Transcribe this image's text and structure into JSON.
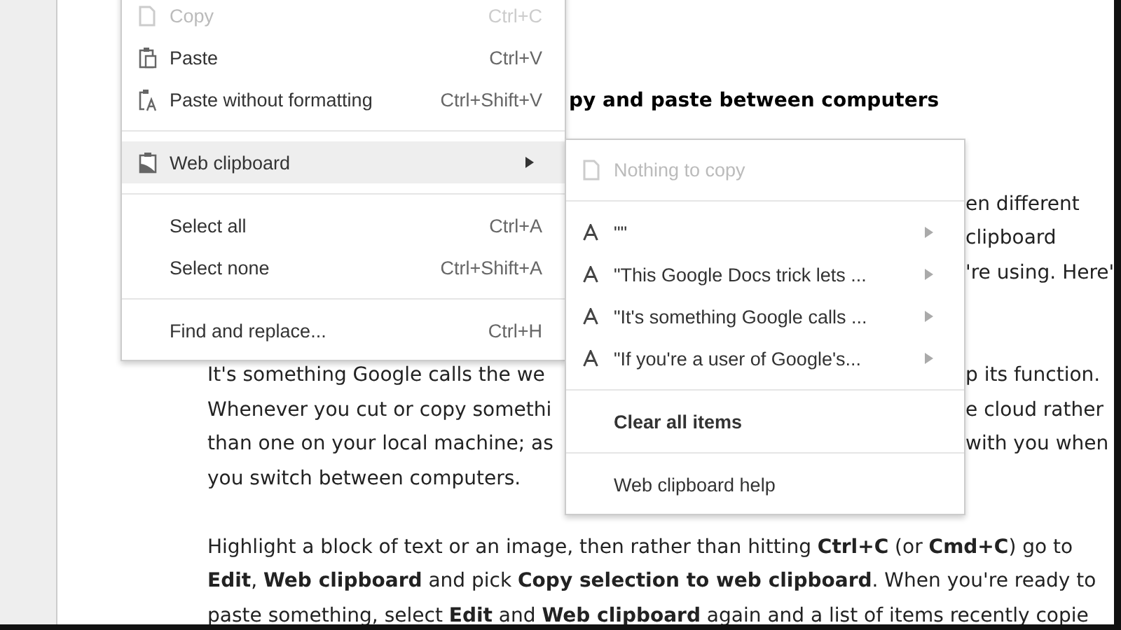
{
  "document": {
    "lines": [
      {
        "kind": "heading",
        "right": "py and paste between computers"
      },
      {
        "kind": "gap"
      },
      {
        "kind": "gap"
      },
      {
        "kind": "text",
        "right": "en different"
      },
      {
        "kind": "text",
        "right": "clipboard"
      },
      {
        "kind": "text",
        "right": "'re using. Here'"
      },
      {
        "kind": "gap"
      },
      {
        "kind": "gap"
      },
      {
        "kind": "text",
        "left": "It's something Google calls the we",
        "right": "p its function."
      },
      {
        "kind": "text",
        "left": "Whenever you cut or copy somethi",
        "right": "e cloud rather"
      },
      {
        "kind": "text",
        "left": "than one on your local machine; as",
        "right": "with you when"
      },
      {
        "kind": "text",
        "left": "you switch between computers."
      },
      {
        "kind": "gap"
      },
      {
        "kind": "text",
        "left": "Highlight a block of text or an image, then rather than hitting **Ctrl+C** (or **Cmd+C**) go to"
      },
      {
        "kind": "text",
        "left": "**Edit**, **Web clipboard** and pick **Copy selection to web clipboard**. When you're ready to"
      },
      {
        "kind": "text",
        "left": "paste something, select **Edit** and **Web clipboard** again and a list of items recently copie"
      }
    ]
  },
  "edit_menu": {
    "items": [
      {
        "kind": "item",
        "label": "Copy",
        "shortcut": "Ctrl+C",
        "disabled": true,
        "selected": false
      },
      {
        "kind": "item",
        "label": "Paste",
        "shortcut": "Ctrl+V",
        "disabled": false,
        "selected": false
      },
      {
        "kind": "item",
        "label": "Paste without formatting",
        "shortcut": "Ctrl+Shift+V",
        "disabled": false,
        "selected": false
      },
      {
        "kind": "separator"
      },
      {
        "kind": "item",
        "label": "Web clipboard",
        "submenu": true,
        "disabled": false,
        "selected": true
      },
      {
        "kind": "separator"
      },
      {
        "kind": "item",
        "label": "Select all",
        "shortcut": "Ctrl+A",
        "disabled": false,
        "selected": false
      },
      {
        "kind": "item",
        "label": "Select none",
        "shortcut": "Ctrl+Shift+A",
        "disabled": false,
        "selected": false
      },
      {
        "kind": "separator"
      },
      {
        "kind": "item",
        "label": "Find and replace...",
        "shortcut": "Ctrl+H",
        "disabled": false,
        "selected": false
      }
    ]
  },
  "web_clipboard_menu": {
    "items": [
      {
        "kind": "empty",
        "label": "Nothing to copy"
      },
      {
        "kind": "separator"
      },
      {
        "kind": "clip",
        "label": "\"\""
      },
      {
        "kind": "clip",
        "label": "\"This Google Docs trick lets ..."
      },
      {
        "kind": "clip",
        "label": "\"It's something Google calls ..."
      },
      {
        "kind": "clip",
        "label": "\"If you're a user of Google's..."
      },
      {
        "kind": "separator"
      },
      {
        "kind": "action",
        "label": "Clear all items"
      },
      {
        "kind": "separator"
      },
      {
        "kind": "help",
        "label": "Web clipboard help"
      }
    ]
  }
}
